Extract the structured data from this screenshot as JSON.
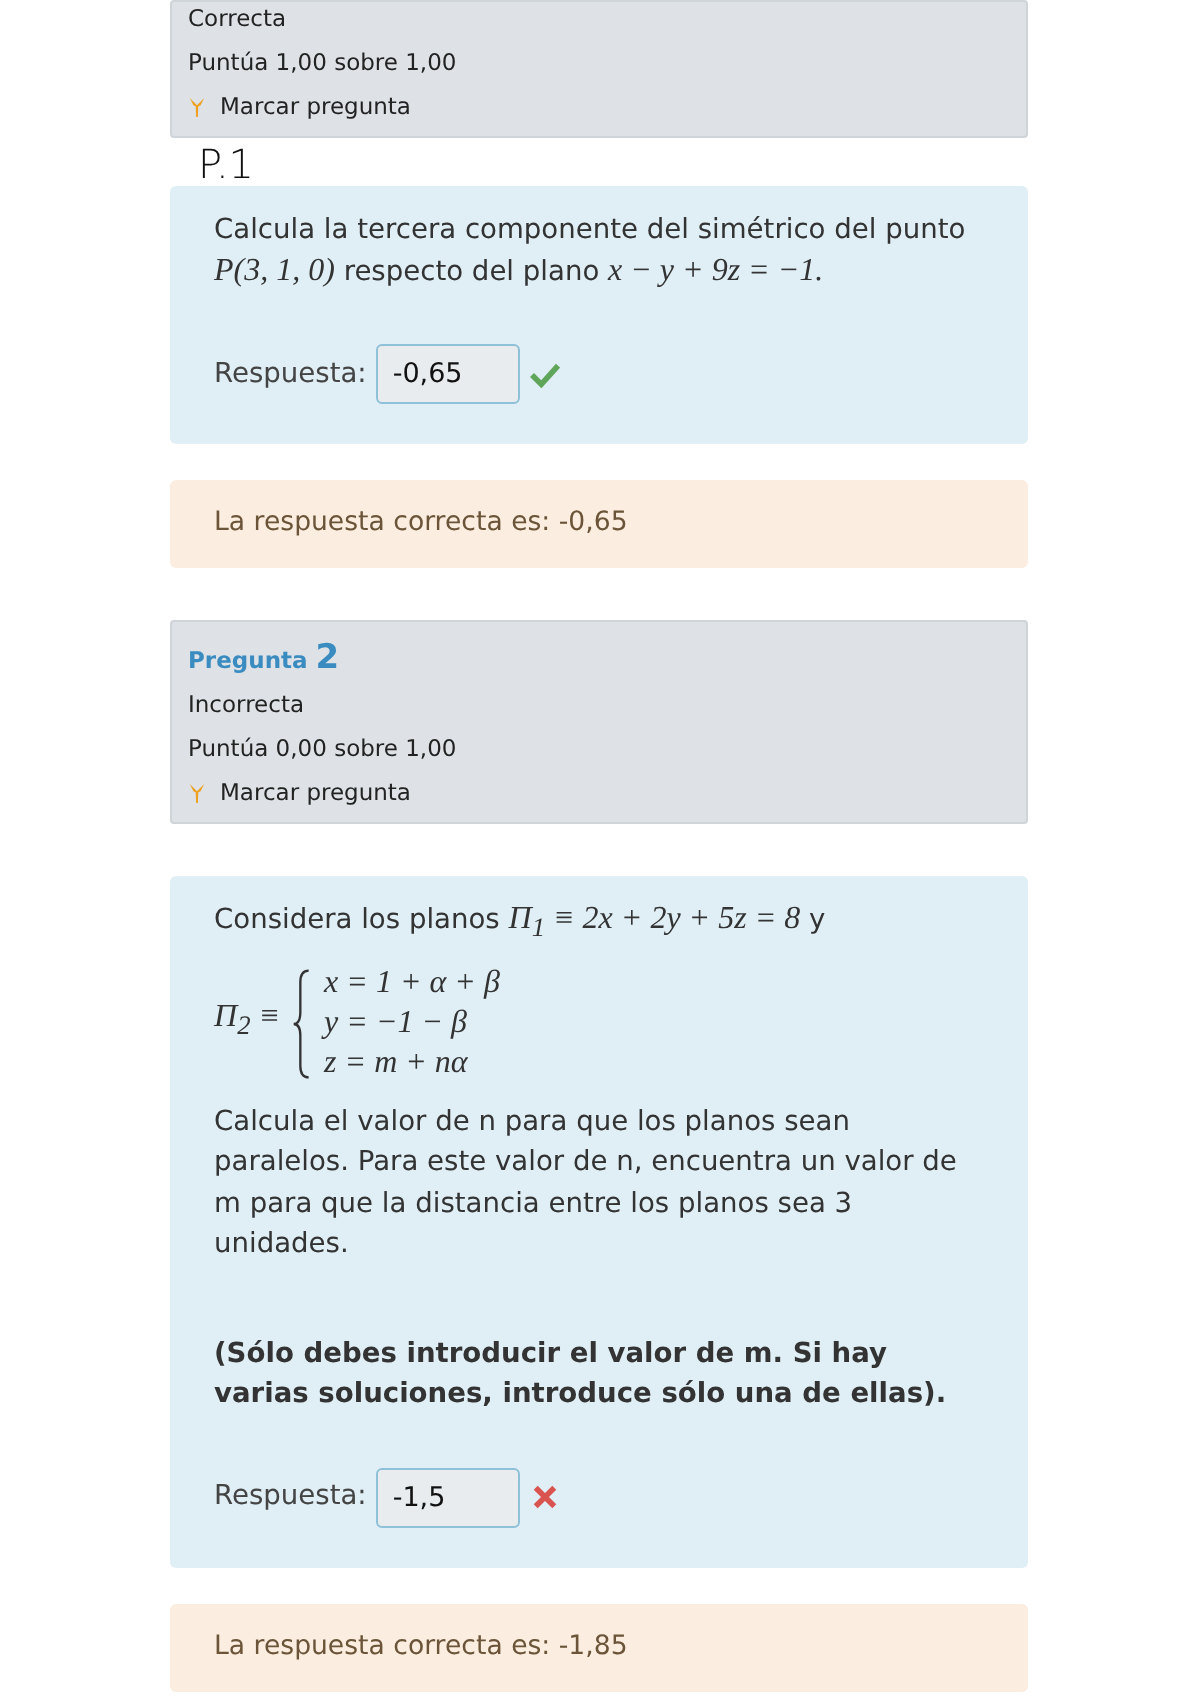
{
  "questions": [
    {
      "info": {
        "status": "Correcta",
        "score": "Puntúa 1,00 sobre 1,00",
        "flag": "Marcar pregunta"
      },
      "annotation": "P.1",
      "content": [
        {
          "kind": "text",
          "parts": [
            {
              "kind": "plain",
              "text": "Calcula la tercera componente del simétrico del punto "
            },
            {
              "kind": "math",
              "text": "P(3, 1, 0)"
            },
            {
              "kind": "plain",
              "text": " respecto del plano "
            },
            {
              "kind": "math",
              "text": "x − y + 9z = −1."
            }
          ]
        }
      ],
      "answer": {
        "label": "Respuesta:",
        "value": "-0,65",
        "correct": true
      },
      "feedback": "La respuesta correcta es: -0,65"
    },
    {
      "info": {
        "title": "Pregunta",
        "number": "2",
        "status": "Incorrecta",
        "score": "Puntúa 0,00 sobre 1,00",
        "flag": "Marcar pregunta"
      },
      "content": [
        {
          "kind": "text",
          "parts": [
            {
              "kind": "plain",
              "text": "Considera los planos "
            },
            {
              "kind": "math",
              "text": "Π$_{1}$ ≡ 2x + 2y + 5z = 8"
            },
            {
              "kind": "plain",
              "text": " y"
            }
          ]
        },
        {
          "kind": "system",
          "lhs": "Π$_{2}$ ≡",
          "lines": [
            "*x* = 1 + *α* + *β*",
            "*y* = −1 − *β*",
            "*z* = *m* + *nα*"
          ]
        },
        {
          "kind": "text",
          "parts": [
            {
              "kind": "plain",
              "text": "Calcula el valor de n para que los planos sean paralelos. Para este valor de n, encuentra un valor de m para que la distancia entre los planos sea 3 unidades."
            }
          ]
        },
        {
          "kind": "note",
          "text": "(Sólo debes introducir el valor de m. Si hay varias soluciones, introduce sólo una de ellas)."
        }
      ],
      "answer": {
        "label": "Respuesta:",
        "value": "-1,5",
        "correct": false
      },
      "feedback": "La respuesta correcta es: -1,85"
    }
  ]
}
